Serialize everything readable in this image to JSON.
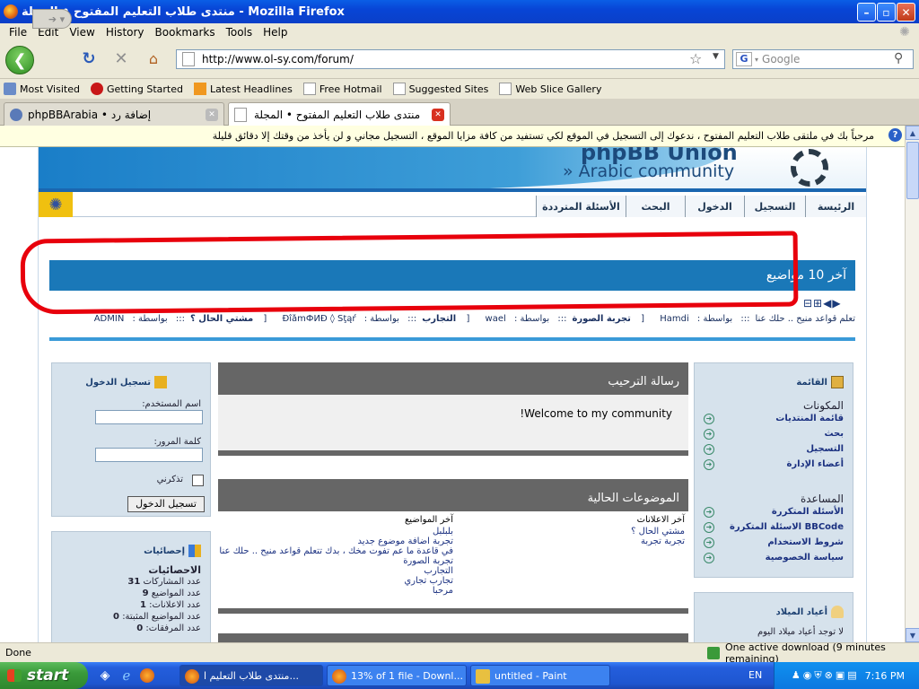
{
  "window": {
    "title": "منتدى طلاب التعليم المفتوح • المجلة - Mozilla Firefox"
  },
  "menu": {
    "items": [
      "File",
      "Edit",
      "View",
      "History",
      "Bookmarks",
      "Tools",
      "Help"
    ]
  },
  "address": {
    "url": "http://www.ol-sy.com/forum/"
  },
  "search": {
    "placeholder": "Google",
    "engine": "G"
  },
  "bookmarks": {
    "items": [
      "Most Visited",
      "Getting Started",
      "Latest Headlines",
      "Free Hotmail",
      "Suggested Sites",
      "Web Slice Gallery"
    ]
  },
  "tabs": [
    {
      "label": "phpBBArabia • إضافة رد"
    },
    {
      "label": "منتدى طلاب التعليم المفتوح • المجلة"
    }
  ],
  "notice": {
    "text": "مرحباً بك في ملتقى طلاب التعليم المفتوح ، ندعوك إلى التسجيل في الموقع لكي تستفيد من كافة مزايا الموقع ، التسجيل مجاني و لن يأخذ من وقتك إلا دقائق قليلة"
  },
  "banner": {
    "brand_top": "phpBB Union",
    "brand_bottom": "» Arabic community"
  },
  "nav": {
    "home": "الرئيسة",
    "register": "التسجيل",
    "login": "الدخول",
    "search": "البحث",
    "faq": "الأسئلة المترددة"
  },
  "latest": {
    "title": "آخر 10 مواضيع",
    "items": [
      {
        "topic": "تعلم قواعد منيح .. حلك عنا",
        "author": "Hamdi"
      },
      {
        "topic": "تجربة الصورة",
        "author": "wael"
      },
      {
        "topic": "التجارب",
        "author": "ÐîåmФИÐ ◊ Šţąŕ"
      },
      {
        "topic": "مشتي الحال ؟",
        "author": "ADMIN"
      }
    ],
    "posted_by": "بواسطة :",
    "sep": ":::",
    "arrows": "⊟⊞◀▶"
  },
  "login": {
    "title": "تسجيل الدخول",
    "username_label": "اسم المستخدم:",
    "password_label": "كلمة المرور:",
    "remember_label": "تذكرني",
    "button": "تسجيل الدخول"
  },
  "stats": {
    "title": "إحصائيات",
    "heading": "الاحصائيات",
    "rows": [
      {
        "label": "عدد المشاركات",
        "value": "31"
      },
      {
        "label": "عدد المواضيع",
        "value": "9"
      },
      {
        "label": "عدد الاعلانات:",
        "value": "1"
      },
      {
        "label": "عدد المواضيع المثبتة:",
        "value": "0"
      },
      {
        "label": "عدد المرفقات:",
        "value": "0"
      }
    ]
  },
  "welcome": {
    "title": "رسالة الترحيب",
    "text": "Welcome to my community!"
  },
  "current": {
    "title": "الموضوعات الحالية",
    "announce_head": "آخر الاعلانات",
    "announcements": [
      "مشتي الحال ؟",
      "تجربة تجربة"
    ],
    "topics_head": "آخر المواضيع",
    "topics": [
      "بلبلبل",
      "تجربة اضافة موضوع جديد",
      "في قاعدة ما عم تفوت مخك ، بدك تتعلم قواعد منيح .. حلك عنا",
      "تجربة الصورة",
      "التجارب",
      "تجارب تجاري",
      "مرحبا"
    ]
  },
  "menu_panel": {
    "title": "القائمة",
    "components_head": "المكونات",
    "components": [
      "قائمة المنتديات",
      "بحث",
      "التسجيل",
      "أعضاء الإدارة"
    ],
    "help_head": "المساعدة",
    "help": [
      "الأسئلة المتكررة",
      "BBCode الاسئلة المتكررة",
      "شروط الاستخدام",
      "سياسة الخصوصية"
    ]
  },
  "birthdays": {
    "title": "أعياد الميلاد",
    "text": "لا توجد أعياد ميلاد اليوم"
  },
  "status": {
    "left": "Done",
    "downloads": "One active download (9 minutes remaining)"
  },
  "taskbar": {
    "start": "start",
    "tasks": [
      "منتدى طلاب التعليم ا...",
      "13% of 1 file - Downl...",
      "untitled - Paint"
    ],
    "lang": "EN",
    "time": "7:16 PM"
  },
  "colors": {
    "accent": "#1a78b8",
    "panel": "#d6e2ec",
    "annotation": "#e8000c"
  }
}
